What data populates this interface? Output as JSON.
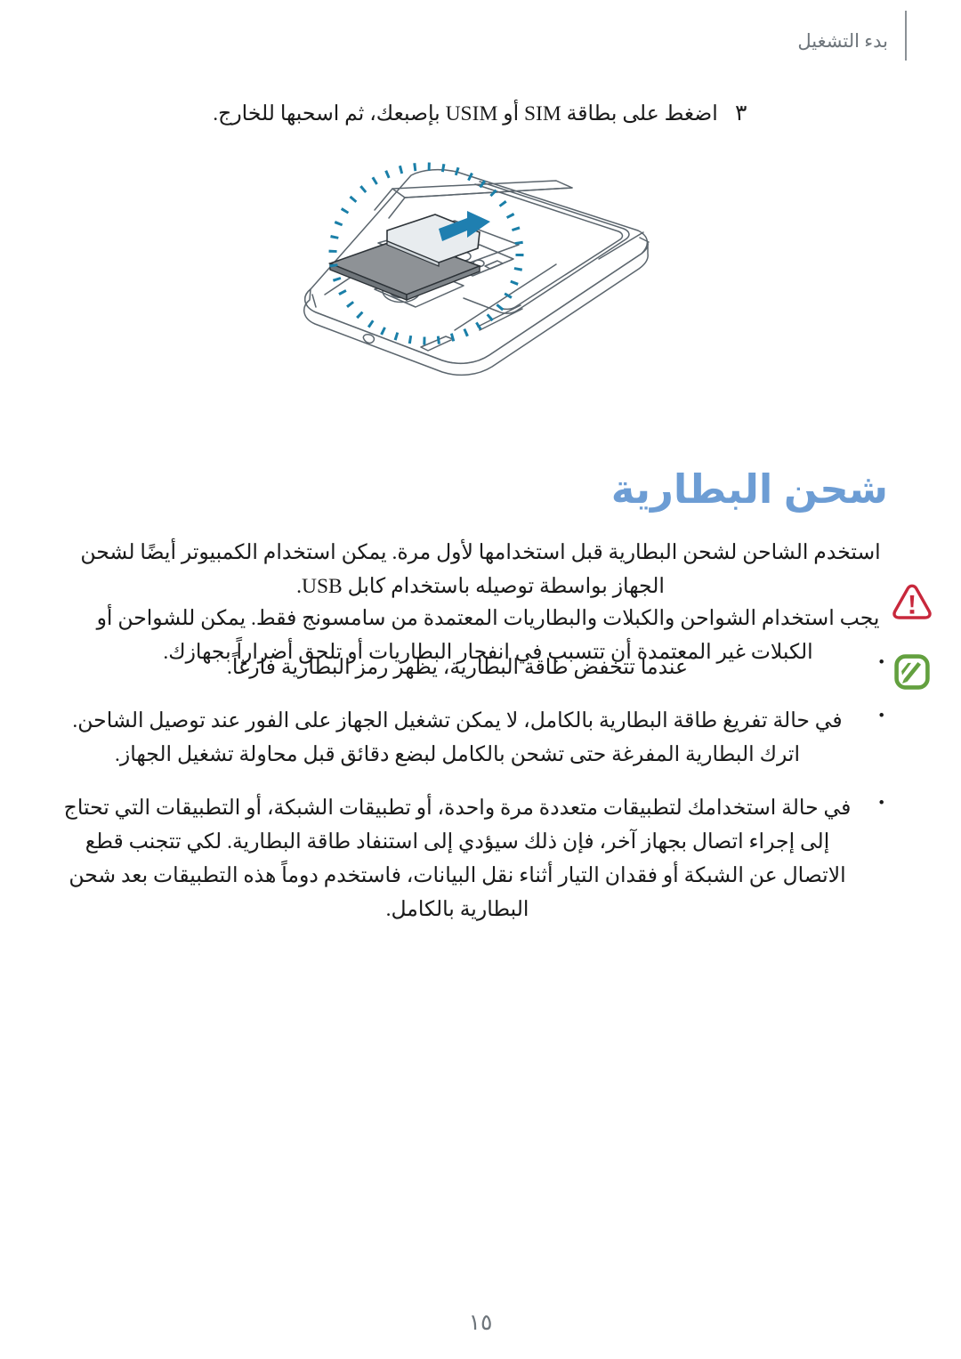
{
  "header": {
    "title": "بدء التشغيل"
  },
  "step": {
    "number": "٣",
    "text": "اضغط على بطاقة SIM أو USIM بإصبعك، ثم اسحبها للخارج."
  },
  "figure": {
    "name": "phone-back-sim-slot-illustration",
    "callout_circle_color": "#1a7fa8",
    "arrow_color": "#1f7fb0",
    "sim_card_color": "#8e9296",
    "outline_color": "#59636b",
    "description_icons": [
      "dotted-circle-highlight",
      "blue-arrow",
      "sim-card",
      "camera-lens",
      "flash-sensor"
    ]
  },
  "section": {
    "heading": "شحن البطارية",
    "heading_color": "#6d9dd4",
    "paragraph": "استخدم الشاحن لشحن البطارية قبل استخدامها لأول مرة. يمكن استخدام الكمبيوتر أيضًا لشحن الجهاز بواسطة توصيله باستخدام كابل USB."
  },
  "warning": {
    "icon": "warning-triangle-icon",
    "icon_color": "#c8283c",
    "text": "يجب استخدام الشواحن والكبلات والبطاريات المعتمدة من سامسونج فقط. يمكن للشواحن أو الكبلات غير المعتمدة أن تتسبب في انفجار البطاريات أو تلحق أضراراً بجهازك."
  },
  "note": {
    "icon": "note-pencil-icon",
    "icon_color": "#63a03f",
    "items": [
      "عندما تتخفض طاقة البطارية، يظهر رمز البطارية فارغاً.",
      "في حالة تفريغ طاقة البطارية بالكامل، لا يمكن تشغيل الجهاز على الفور عند توصيل الشاحن. اترك البطارية المفرغة حتى تشحن بالكامل لبضع دقائق قبل محاولة تشغيل الجهاز.",
      "في حالة استخدامك لتطبيقات متعددة مرة واحدة، أو تطبيقات الشبكة، أو التطبيقات التي تحتاج إلى إجراء اتصال بجهاز آخر، فإن ذلك سيؤدي إلى استنفاد طاقة البطارية. لكي تتجنب قطع الاتصال عن الشبكة أو فقدان التيار أثناء نقل البيانات، فاستخدم دوماً هذه التطبيقات بعد شحن البطارية بالكامل."
    ]
  },
  "footer": {
    "page_number": "١٥"
  }
}
